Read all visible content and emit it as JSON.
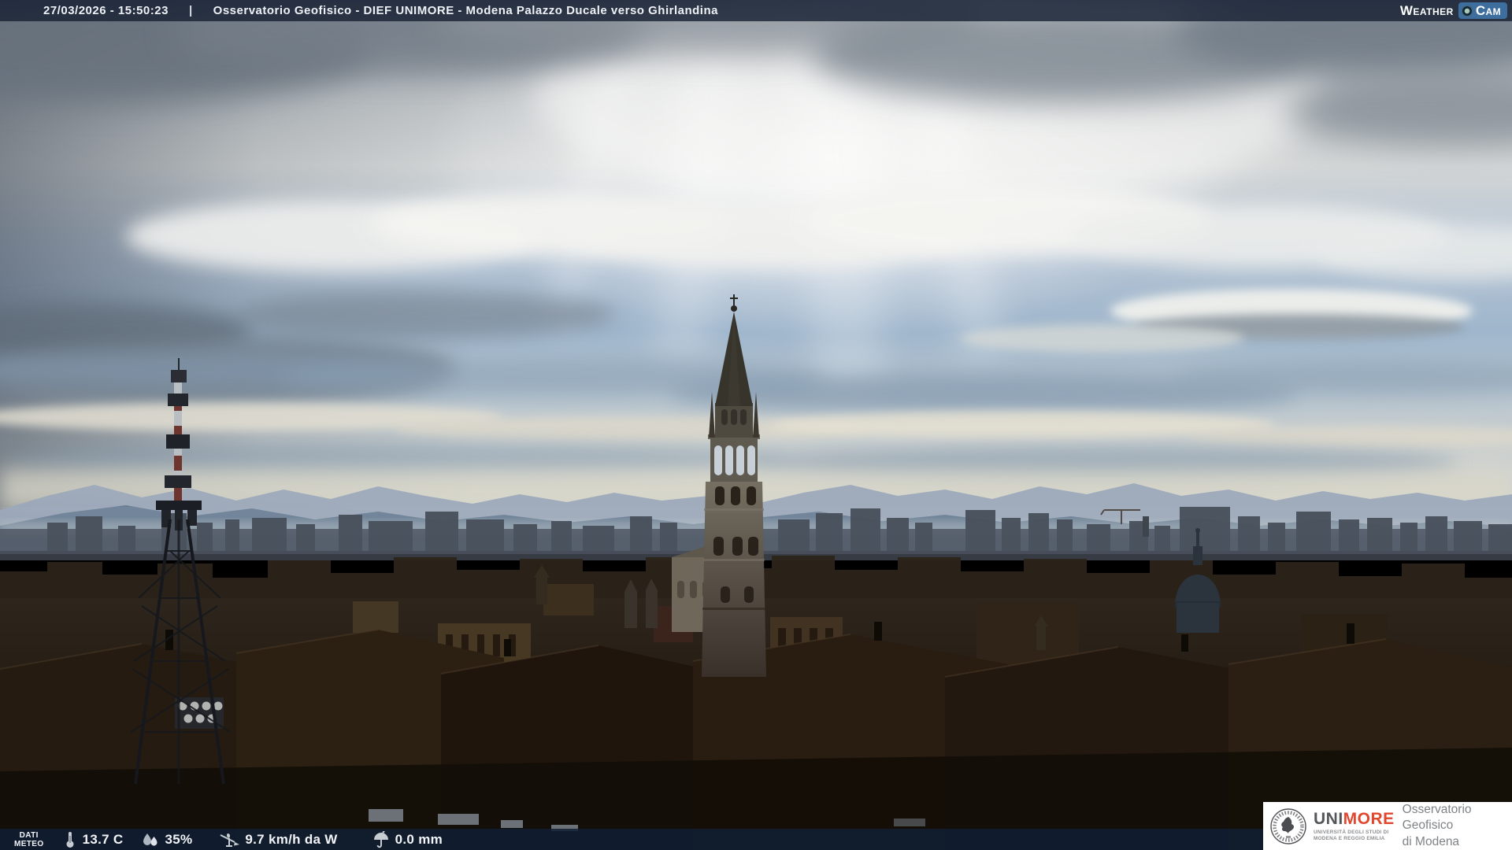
{
  "header": {
    "datetime": "27/03/2026 - 15:50:23",
    "separator": "|",
    "title": "Osservatorio Geofisico - DIEF UNIMORE - Modena Palazzo Ducale verso Ghirlandina",
    "logo": {
      "weather": "Weather",
      "cam": "Cam"
    }
  },
  "footer": {
    "label_line1": "DATI",
    "label_line2": "METEO",
    "metrics": [
      {
        "name": "temperature",
        "icon": "thermometer-icon",
        "value": "13.7 C"
      },
      {
        "name": "humidity",
        "icon": "humidity-icon",
        "value": "35%"
      },
      {
        "name": "wind",
        "icon": "wind-vane-icon",
        "value": "9.7 km/h da W"
      },
      {
        "name": "precipitation",
        "icon": "umbrella-icon",
        "value": "0.0 mm"
      }
    ]
  },
  "branding": {
    "unimore_prefix": "UNI",
    "unimore_suffix": "MORE",
    "university_line1": "UNIVERSITÀ DEGLI STUDI DI",
    "university_line2": "MODENA E REGGIO EMILIA",
    "observatory_line1": "Osservatorio Geofisico",
    "observatory_line2": "di Modena"
  },
  "scene": {
    "description": "Afternoon webcam view over the rooftops of Modena toward the Ghirlandina tower, with a telecom antenna mast on the left, a church dome on the right and the Apennine mountains hazy on the horizon under banded clouds with sun glare",
    "landmarks": [
      "Ghirlandina tower",
      "telecom antenna mast",
      "church dome",
      "Duomo apse",
      "Apennine mountains"
    ],
    "colors": {
      "weathercam_badge_blue": "#3d6e9e",
      "unimore_red": "#e1472e",
      "overlay_bar_navy": "#14243c",
      "sky_blue": "#9fb6cc",
      "haze_cream": "#dcd9cb",
      "mountain_blue": "#64798f",
      "city_dark_brown": "#1d150c"
    }
  }
}
